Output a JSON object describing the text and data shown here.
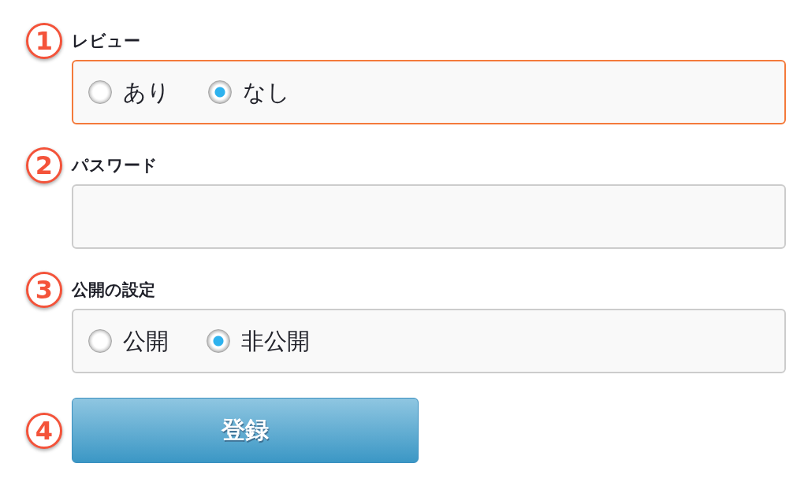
{
  "form": {
    "sections": [
      {
        "marker": "1",
        "label": "レビュー",
        "kind": "radio",
        "focused": true,
        "options": [
          {
            "label": "あり",
            "selected": false
          },
          {
            "label": "なし",
            "selected": true
          }
        ]
      },
      {
        "marker": "2",
        "label": "パスワード",
        "kind": "password",
        "focused": false
      },
      {
        "marker": "3",
        "label": "公開の設定",
        "kind": "radio",
        "focused": false,
        "options": [
          {
            "label": "公開",
            "selected": false
          },
          {
            "label": "非公開",
            "selected": true
          }
        ]
      }
    ],
    "submit": {
      "marker": "4",
      "label": "登録"
    }
  }
}
